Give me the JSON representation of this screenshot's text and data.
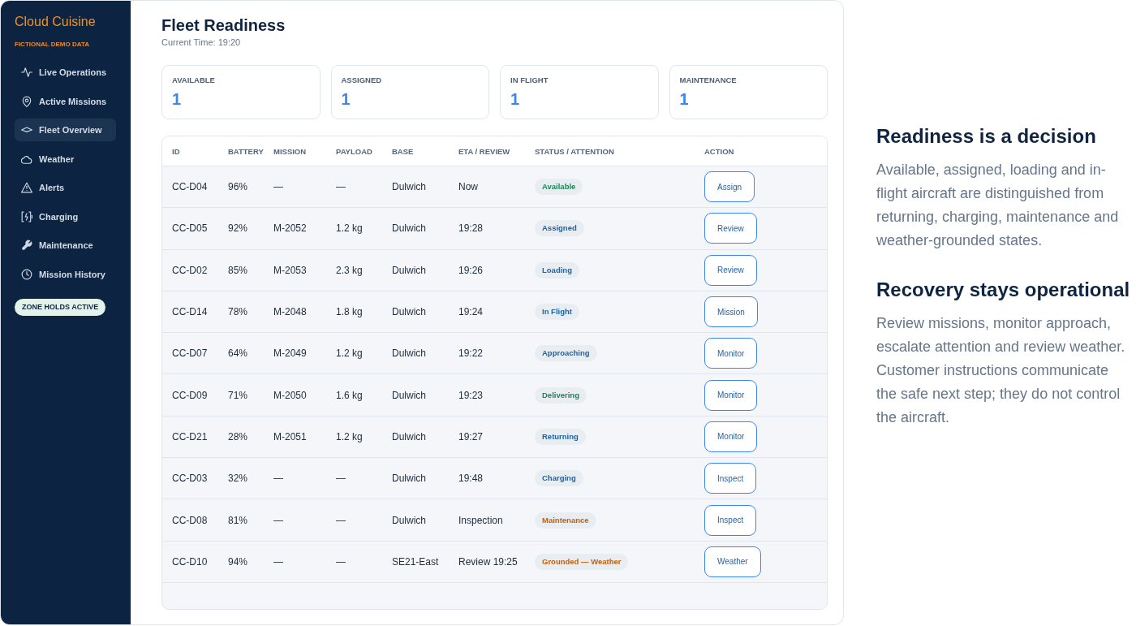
{
  "sidebar": {
    "brand": "Cloud Cuisine",
    "tagline": "FICTIONAL DEMO DATA",
    "items": [
      {
        "label": "Live Operations",
        "selected": false
      },
      {
        "label": "Active Missions",
        "selected": false
      },
      {
        "label": "Fleet Overview",
        "selected": true
      },
      {
        "label": "Weather",
        "selected": false
      },
      {
        "label": "Alerts",
        "selected": false
      },
      {
        "label": "Charging",
        "selected": false
      },
      {
        "label": "Maintenance",
        "selected": false
      },
      {
        "label": "Mission History",
        "selected": false
      }
    ],
    "badge": "ZONE HOLDS ACTIVE"
  },
  "header": {
    "title": "Fleet Readiness",
    "subtitle": "Current Time: 19:20"
  },
  "stats": [
    {
      "label": "AVAILABLE",
      "value": "1"
    },
    {
      "label": "ASSIGNED",
      "value": "1"
    },
    {
      "label": "IN FLIGHT",
      "value": "1"
    },
    {
      "label": "MAINTENANCE",
      "value": "1"
    }
  ],
  "table": {
    "columns": [
      "ID",
      "BATTERY",
      "MISSION",
      "PAYLOAD",
      "BASE",
      "ETA / REVIEW",
      "STATUS / ATTENTION",
      "ACTION"
    ],
    "rows": [
      {
        "cells": [
          "CC-D04",
          "96%",
          "—",
          "—",
          "Dulwich",
          "Now"
        ],
        "status": {
          "label": "Available",
          "color": "#1f8656"
        },
        "action": "Assign"
      },
      {
        "cells": [
          "CC-D05",
          "92%",
          "M-2052",
          "1.2 kg",
          "Dulwich",
          "19:28"
        ],
        "status": {
          "label": "Assigned",
          "color": "#1d63a8"
        },
        "action": "Review"
      },
      {
        "cells": [
          "CC-D02",
          "85%",
          "M-2053",
          "2.3 kg",
          "Dulwich",
          "19:26"
        ],
        "status": {
          "label": "Loading",
          "color": "#1d63a8"
        },
        "action": "Review"
      },
      {
        "cells": [
          "CC-D14",
          "78%",
          "M-2048",
          "1.8 kg",
          "Dulwich",
          "19:24"
        ],
        "status": {
          "label": "In Flight",
          "color": "#1d63a8"
        },
        "action": "Mission"
      },
      {
        "cells": [
          "CC-D07",
          "64%",
          "M-2049",
          "1.2 kg",
          "Dulwich",
          "19:22"
        ],
        "status": {
          "label": "Approaching",
          "color": "#1d63a8"
        },
        "action": "Monitor"
      },
      {
        "cells": [
          "CC-D09",
          "71%",
          "M-2050",
          "1.6 kg",
          "Dulwich",
          "19:23"
        ],
        "status": {
          "label": "Delivering",
          "color": "#1f8656"
        },
        "action": "Monitor"
      },
      {
        "cells": [
          "CC-D21",
          "28%",
          "M-2051",
          "1.2 kg",
          "Dulwich",
          "19:27"
        ],
        "status": {
          "label": "Returning",
          "color": "#1d63a8"
        },
        "action": "Monitor"
      },
      {
        "cells": [
          "CC-D03",
          "32%",
          "—",
          "—",
          "Dulwich",
          "19:48"
        ],
        "status": {
          "label": "Charging",
          "color": "#1d63a8"
        },
        "action": "Inspect"
      },
      {
        "cells": [
          "CC-D08",
          "81%",
          "—",
          "—",
          "Dulwich",
          "Inspection"
        ],
        "status": {
          "label": "Maintenance",
          "color": "#c0600f"
        },
        "action": "Inspect"
      },
      {
        "cells": [
          "CC-D10",
          "94%",
          "—",
          "—",
          "SE21-East",
          "Review 19:25"
        ],
        "status": {
          "label": "Grounded — Weather",
          "color": "#c0600f"
        },
        "action": "Weather"
      }
    ]
  },
  "notes": [
    {
      "heading": "Readiness is a decision",
      "body": "Available, assigned, loading and in-flight aircraft are distinguished from returning, charging, maintenance and weather-grounded states."
    },
    {
      "heading": "Recovery stays operational",
      "body": "Review missions, monitor approach, escalate attention and review weather. Customer instructions communicate the safe next step; they do not control the aircraft."
    }
  ]
}
